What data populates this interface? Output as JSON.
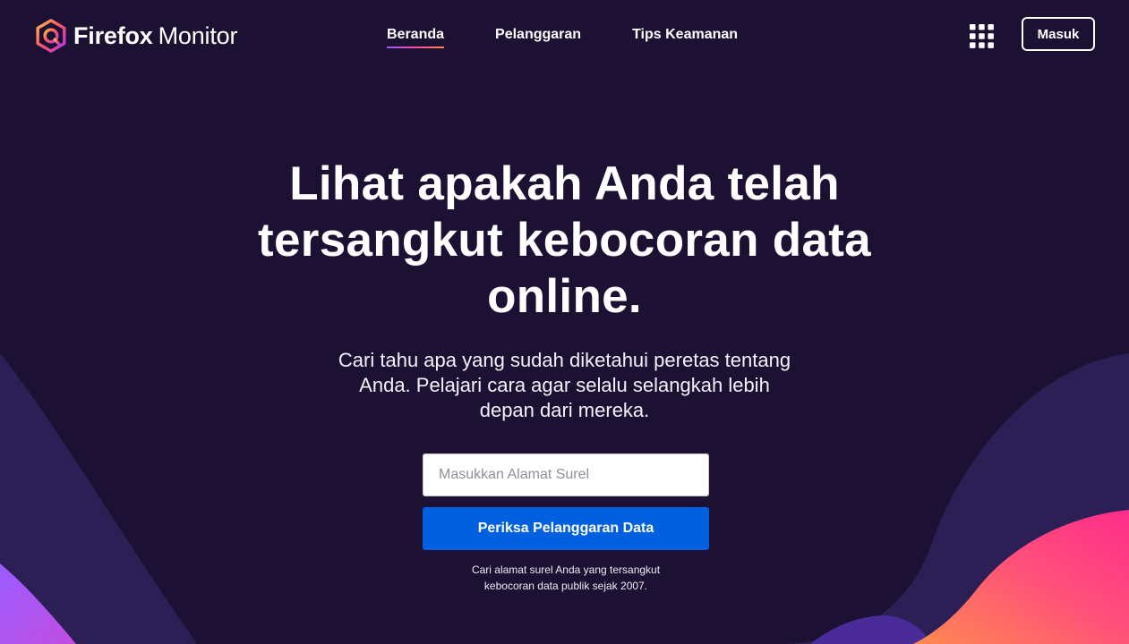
{
  "brand": {
    "name": "Firefox",
    "product": "Monitor"
  },
  "nav": {
    "items": [
      {
        "label": "Beranda",
        "active": true
      },
      {
        "label": "Pelanggaran",
        "active": false
      },
      {
        "label": "Tips Keamanan",
        "active": false
      }
    ]
  },
  "header": {
    "apps_icon": "grid-apps-icon",
    "signin_label": "Masuk"
  },
  "hero": {
    "title": "Lihat apakah Anda telah tersangkut kebocoran data online.",
    "subtitle": "Cari tahu apa yang sudah diketahui peretas tentang Anda. Pelajari cara agar selalu selangkah lebih depan dari mereka."
  },
  "form": {
    "email_placeholder": "Masukkan Alamat Surel",
    "email_value": "",
    "submit_label": "Periksa Pelanggaran Data",
    "note_line1": "Cari alamat surel Anda yang tersangkut",
    "note_line2": "kebocoran data publik sejak 2007."
  },
  "colors": {
    "background": "#1d1133",
    "accent_blue": "#0060df",
    "gradient_pink": "#ff4aa2",
    "gradient_orange": "#ff7139",
    "gradient_purple": "#9059ff"
  }
}
